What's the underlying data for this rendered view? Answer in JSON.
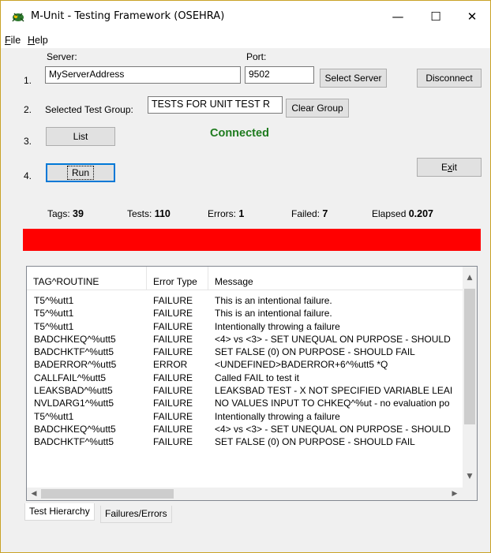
{
  "window": {
    "title": "M-Unit - Testing Framework (OSEHRA)",
    "minimize_glyph": "—",
    "maximize_glyph": "☐",
    "close_glyph": "✕"
  },
  "menu": {
    "file_u": "F",
    "file_rest": "ile",
    "help_u": "H",
    "help_rest": "elp"
  },
  "steps": [
    "1.",
    "2.",
    "3.",
    "4."
  ],
  "server": {
    "server_label": "Server:",
    "server_value": "MyServerAddress",
    "port_label": "Port:",
    "port_value": "9502",
    "select_server_label": "Select Server",
    "disconnect_label": "Disconnect"
  },
  "test_group": {
    "label": "Selected Test Group:",
    "value": "TESTS FOR UNIT TEST R",
    "clear_label": "Clear Group"
  },
  "actions": {
    "list_label": "List",
    "run_label": "Run",
    "exit_prefix": "E",
    "exit_u": "x",
    "exit_suffix": "it"
  },
  "connection_status": "Connected",
  "stats": {
    "tags_label": "Tags:",
    "tags_value": "39",
    "tests_label": "Tests:",
    "tests_value": "110",
    "errors_label": "Errors:",
    "errors_value": "1",
    "failed_label": "Failed:",
    "failed_value": "7",
    "elapsed_label": "Elapsed",
    "elapsed_value": "0.207"
  },
  "status_bar_color": "#ff0000",
  "results": {
    "columns": [
      "TAG^ROUTINE",
      "Error Type",
      "Message"
    ],
    "rows": [
      [
        "T5^%utt1",
        "FAILURE",
        "This is an intentional failure."
      ],
      [
        "T5^%utt1",
        "FAILURE",
        "This is an intentional failure."
      ],
      [
        "T5^%utt1",
        "FAILURE",
        "Intentionally throwing a failure"
      ],
      [
        "BADCHKEQ^%utt5",
        "FAILURE",
        "<4> vs <3> - SET UNEQUAL ON PURPOSE - SHOULD"
      ],
      [
        "BADCHKTF^%utt5",
        "FAILURE",
        "SET FALSE (0) ON PURPOSE - SHOULD FAIL"
      ],
      [
        "BADERROR^%utt5",
        "ERROR",
        "<UNDEFINED>BADERROR+6^%utt5 *Q"
      ],
      [
        "CALLFAIL^%utt5",
        "FAILURE",
        "Called FAIL to test it"
      ],
      [
        "LEAKSBAD^%utt5",
        "FAILURE",
        "LEAKSBAD TEST - X NOT SPECIFIED VARIABLE LEAI"
      ],
      [
        "NVLDARG1^%utt5",
        "FAILURE",
        "NO VALUES INPUT TO CHKEQ^%ut - no evaluation po"
      ],
      [
        "T5^%utt1",
        "FAILURE",
        "Intentionally throwing a failure"
      ],
      [
        "BADCHKEQ^%utt5",
        "FAILURE",
        "<4> vs <3> - SET UNEQUAL ON PURPOSE - SHOULD"
      ],
      [
        "BADCHKTF^%utt5",
        "FAILURE",
        "SET FALSE (0) ON PURPOSE - SHOULD FAIL"
      ]
    ]
  },
  "tabs": [
    "Test Hierarchy",
    "Failures/Errors"
  ]
}
